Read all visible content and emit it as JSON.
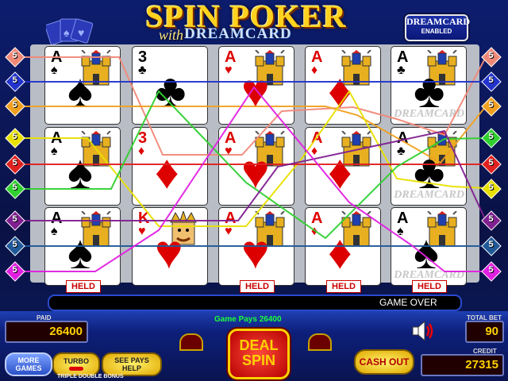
{
  "game": {
    "title": "SPIN POKER",
    "title_with": "with",
    "title_dreamcard": "DREAMCARD",
    "badge_line1": "DREAMCARD",
    "badge_line2": "ENABLED",
    "dreamcard_watermark": "DREAMCARD"
  },
  "cards": [
    [
      {
        "rank": "A",
        "suit": "♠",
        "color": "#000",
        "castle": true
      },
      {
        "rank": "3",
        "suit": "♣",
        "color": "#000",
        "castle": false
      },
      {
        "rank": "A",
        "suit": "♥",
        "color": "#d00",
        "castle": true
      },
      {
        "rank": "A",
        "suit": "♦",
        "color": "#d00",
        "castle": true
      },
      {
        "rank": "A",
        "suit": "♣",
        "color": "#000",
        "castle": true,
        "watermark": true
      }
    ],
    [
      {
        "rank": "A",
        "suit": "♠",
        "color": "#000",
        "castle": true
      },
      {
        "rank": "3",
        "suit": "♦",
        "color": "#d00",
        "castle": false
      },
      {
        "rank": "A",
        "suit": "♥",
        "color": "#d00",
        "castle": true
      },
      {
        "rank": "A",
        "suit": "♦",
        "color": "#d00",
        "castle": true
      },
      {
        "rank": "A",
        "suit": "♣",
        "color": "#000",
        "castle": true,
        "watermark": true
      }
    ],
    [
      {
        "rank": "A",
        "suit": "♠",
        "color": "#000",
        "castle": true
      },
      {
        "rank": "K",
        "suit": "♥",
        "color": "#d00",
        "castle": false,
        "king": true
      },
      {
        "rank": "A",
        "suit": "♥",
        "color": "#d00",
        "castle": true
      },
      {
        "rank": "A",
        "suit": "♦",
        "color": "#d00",
        "castle": true
      },
      {
        "rank": "A",
        "suit": "♠",
        "color": "#000",
        "castle": true,
        "watermark": true
      }
    ]
  ],
  "held": [
    "HELD",
    "",
    "HELD",
    "HELD",
    "HELD"
  ],
  "paylines_left": [
    {
      "num": "5",
      "color": "#f08878"
    },
    {
      "num": "5",
      "color": "#2233cc"
    },
    {
      "num": "5",
      "color": "#f0a020"
    },
    {
      "num": "5",
      "color": "#e8e000"
    },
    {
      "num": "5",
      "color": "#e02020"
    },
    {
      "num": "5",
      "color": "#30d030"
    },
    {
      "num": "5",
      "color": "#802090"
    },
    {
      "num": "5",
      "color": "#205898"
    },
    {
      "num": "5",
      "color": "#e020e0"
    }
  ],
  "paylines_right": [
    {
      "num": "5",
      "color": "#f08878"
    },
    {
      "num": "5",
      "color": "#2233cc"
    },
    {
      "num": "5",
      "color": "#f0a020"
    },
    {
      "num": "5",
      "color": "#30d030"
    },
    {
      "num": "5",
      "color": "#e02020"
    },
    {
      "num": "5",
      "color": "#e8e000"
    },
    {
      "num": "5",
      "color": "#802090"
    },
    {
      "num": "5",
      "color": "#205898"
    },
    {
      "num": "5",
      "color": "#e020e0"
    }
  ],
  "message": "GAME OVER",
  "game_pays": "Game Pays 26400",
  "meters": {
    "paid_label": "PAID",
    "paid_value": "26400",
    "total_bet_label": "TOTAL BET",
    "total_bet_value": "90",
    "credit_label": "CREDIT",
    "credit_value": "27315"
  },
  "buttons": {
    "more_games": "MORE GAMES",
    "turbo": "TURBO",
    "see_pays": "SEE PAYS HELP",
    "deal_line1": "DEAL",
    "deal_line2": "SPIN",
    "cash_out": "CASH OUT"
  },
  "game_name": "TRIPLE DOUBLE BONUS",
  "icons": {
    "sound": "speaker-icon",
    "castle": "castle-icon"
  }
}
